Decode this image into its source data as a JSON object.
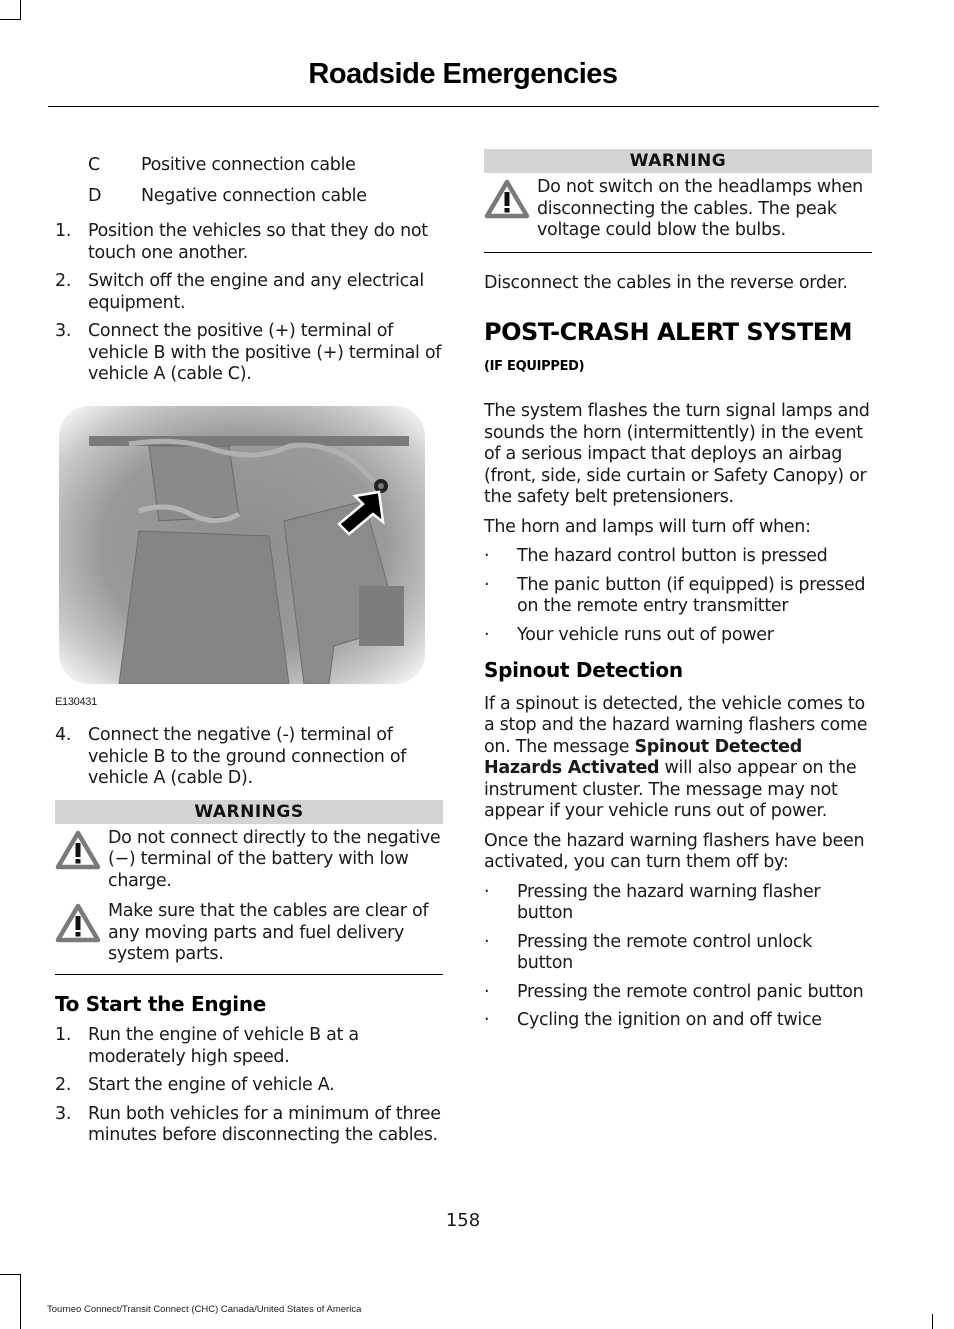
{
  "header": {
    "title": "Roadside Emergencies"
  },
  "left": {
    "key": [
      {
        "letter": "C",
        "label": "Positive connection cable"
      },
      {
        "letter": "D",
        "label": "Negative connection cable"
      }
    ],
    "steps": [
      {
        "num": "1.",
        "text": "Position the vehicles so that they do not touch one another."
      },
      {
        "num": "2.",
        "text": "Switch off the engine and any electrical equipment."
      },
      {
        "num": "3.",
        "text": "Connect the positive (+) terminal of vehicle B with the positive (+) terminal of vehicle A (cable C)."
      }
    ],
    "figure": {
      "code": "E130431",
      "icon": "arrow-pointer-icon"
    },
    "step4": {
      "num": "4.",
      "text": "Connect the negative (-) terminal of vehicle B to the ground connection of vehicle A (cable D)."
    },
    "warnings": {
      "heading": "WARNINGS",
      "items": [
        "Do not connect directly to the negative (−) terminal of the battery with low charge.",
        "Make sure that the cables are clear of any moving parts and fuel delivery system parts."
      ]
    },
    "start_engine": {
      "heading": "To Start the Engine",
      "steps": [
        {
          "num": "1.",
          "text": "Run the engine of vehicle B at a moderately high speed."
        },
        {
          "num": "2.",
          "text": "Start the engine of vehicle A."
        },
        {
          "num": "3.",
          "text": "Run both vehicles for a minimum of three minutes before disconnecting the cables."
        }
      ]
    }
  },
  "right": {
    "warning": {
      "heading": "WARNING",
      "text": "Do not switch on the headlamps when disconnecting the cables. The peak voltage could blow the bulbs."
    },
    "disconnect": "Disconnect the cables in the reverse order.",
    "post_crash": {
      "heading": "POST-CRASH ALERT SYSTEM",
      "sub": "(IF EQUIPPED)",
      "intro": "The system flashes the turn signal lamps and sounds the horn (intermittently) in the event of a serious impact that deploys an airbag (front, side, side curtain or Safety Canopy) or the safety belt pretensioners.",
      "turn_off_intro": "The horn and lamps will turn off when:",
      "bullets": [
        "The hazard control button is pressed",
        "The panic button (if equipped) is pressed on the remote entry transmitter",
        "Your vehicle runs out of power"
      ]
    },
    "spinout": {
      "heading": "Spinout Detection",
      "p1_before": "If a spinout is detected, the vehicle comes to a stop and the hazard warning flashers come on. The message ",
      "p1_bold": "Spinout Detected Hazards Activated",
      "p1_after": " will also appear on the instrument cluster. The message may not appear if your vehicle runs out of power.",
      "p2": "Once the hazard warning flashers have been activated, you can turn them off by:",
      "bullets": [
        "Pressing the hazard warning flasher button",
        "Pressing the remote control unlock button",
        "Pressing the remote control panic button",
        "Cycling the ignition on and off twice"
      ]
    }
  },
  "page_number": "158",
  "footer": "Tourneo Connect/Transit Connect (CHC) Canada/United States of America"
}
